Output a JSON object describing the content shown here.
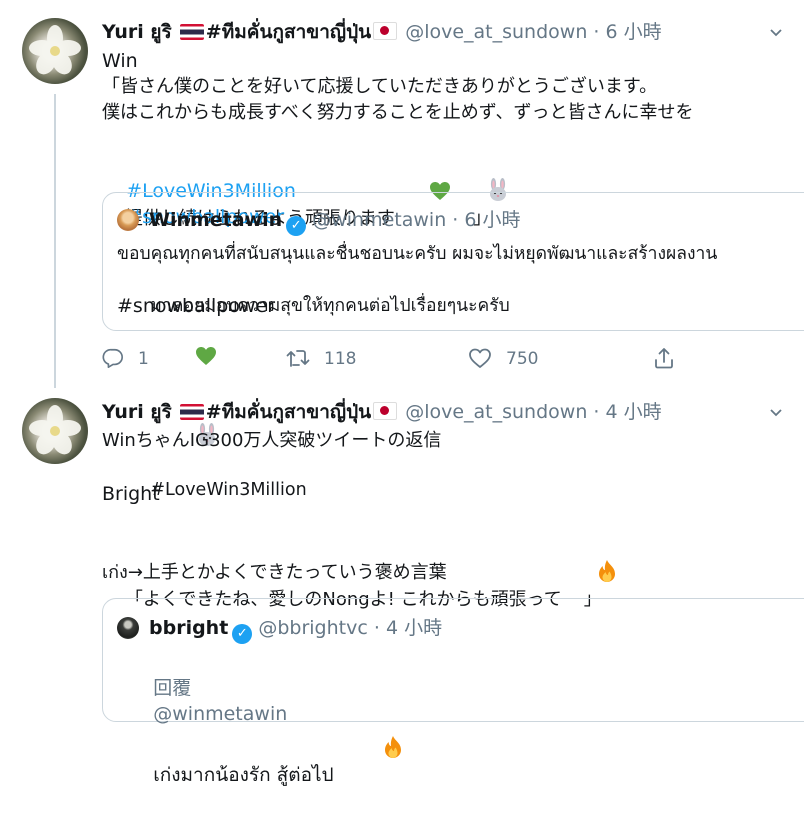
{
  "tweet1": {
    "display_name": "Yuri ยูริ",
    "group_name": "#ทีมคั่นกูสาขาญี่ปุ่น",
    "handle": "@love_at_sundown",
    "time": "· 6 小時",
    "line1": "Win",
    "line2": "「皆さん僕のことを好いて応援していただきありがとうございます。",
    "line3": "僕はこれからも成長すべく努力することを止めず、ずっと皆さんに幸せを",
    "line4_a": "提供し続けられるよう頑張ります",
    "line4_b": "」",
    "hashtag1": "#LoveWin3Million",
    "hashtag2": "#snowballpower",
    "quote": {
      "display_name": "Winmetawin",
      "handle": "@winmetawin",
      "time": "· 6 小時",
      "line1": "ขอบคุณทุกคนที่สนับสนุนและชื่นชอบนะครับ ผมจะไม่หยุดพัฒนาและสร้างผลงาน",
      "line2_a": "มาคอยมอบความสุขให้ทุกคนต่อไปเรื่อยๆนะครับ",
      "line2_b": "#LoveWin3Million",
      "line3": "#snowballpower"
    },
    "replies": "1",
    "retweets": "118",
    "likes": "750"
  },
  "tweet2": {
    "display_name": "Yuri ยูริ",
    "group_name": "#ทีมคั่นกูสาขาญี่ปุ่น",
    "handle": "@love_at_sundown",
    "time": "· 4 小時",
    "line1": "WinちゃんIG300万人突破ツイートの返信",
    "line2": "Bright",
    "line3": "「よくできたね、愛しのNongよ! これからも頑張って",
    "line3_end": "」",
    "line4": "เก่ง→上手とかよくできたっていう褒め言葉",
    "quote": {
      "display_name": "bbright",
      "handle": "@bbrightvc",
      "time": "· 4 小時",
      "reply_to_label": "回覆",
      "reply_to_handle": "@winmetawin",
      "text": "เก่งมากน้องรัก สู้ต่อไป"
    }
  },
  "colors": {
    "link": "#1da1f2",
    "secondary": "#657786",
    "border": "#ccd6dd",
    "green_heart": "#4cae4c"
  }
}
